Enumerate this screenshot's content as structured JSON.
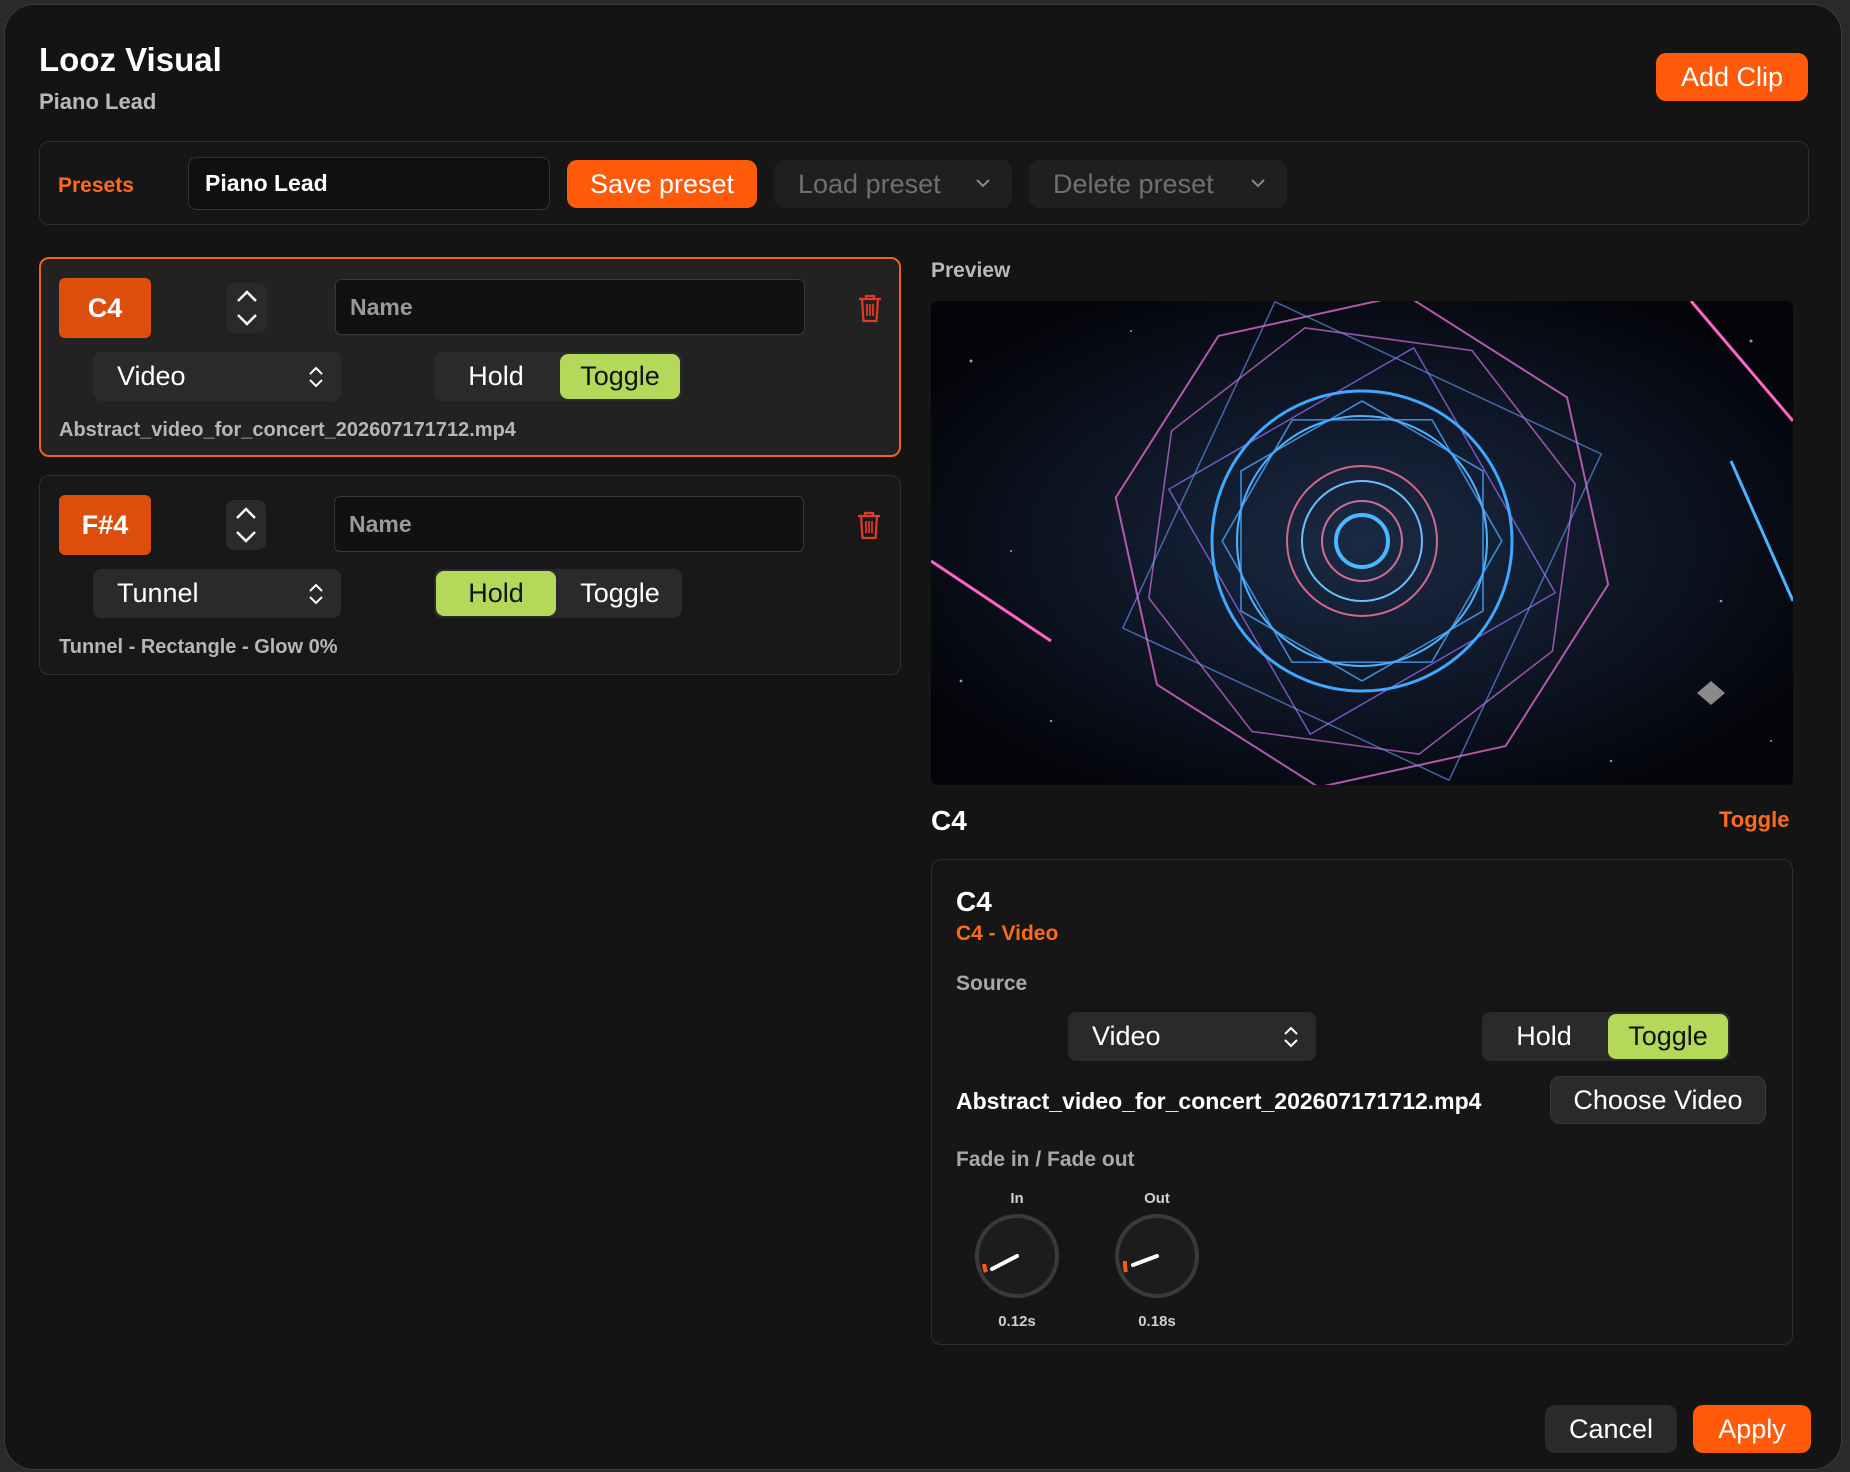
{
  "app": {
    "title": "Looz Visual",
    "subtitle": "Piano Lead",
    "add_clip_label": "Add Clip"
  },
  "presets": {
    "label": "Presets",
    "name_value": "Piano Lead",
    "save_label": "Save preset",
    "load_label": "Load preset",
    "delete_label": "Delete preset"
  },
  "clips": [
    {
      "note": "C4",
      "name_placeholder": "Name",
      "source": "Video",
      "modes": [
        "Hold",
        "Toggle"
      ],
      "active_mode": "Toggle",
      "description": "Abstract_video_for_concert_202607171712.mp4",
      "selected": true
    },
    {
      "note": "F#4",
      "name_placeholder": "Name",
      "source": "Tunnel",
      "modes": [
        "Hold",
        "Toggle"
      ],
      "active_mode": "Hold",
      "description": "Tunnel - Rectangle - Glow 0%",
      "selected": false
    }
  ],
  "preview": {
    "label": "Preview"
  },
  "selected": {
    "note": "C4",
    "mode": "Toggle",
    "detail_title": "C4",
    "detail_subtitle": "C4 - Video",
    "source_label": "Source",
    "source": "Video",
    "modes": [
      "Hold",
      "Toggle"
    ],
    "active_mode": "Toggle",
    "file_name": "Abstract_video_for_concert_202607171712.mp4",
    "choose_label": "Choose Video",
    "fade_label": "Fade in / Fade out",
    "fade_in": {
      "label": "In",
      "value": "0.12s"
    },
    "fade_out": {
      "label": "Out",
      "value": "0.18s"
    }
  },
  "footer": {
    "cancel_label": "Cancel",
    "apply_label": "Apply"
  },
  "colors": {
    "accent": "#ff5a0a",
    "active_toggle": "#b4d95a",
    "badge": "#dd4e0c",
    "trash": "#e03a2a"
  }
}
